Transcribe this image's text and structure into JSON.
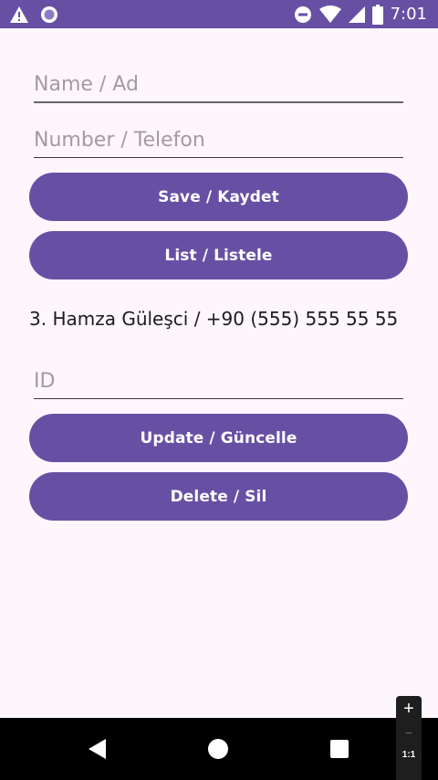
{
  "status_bar": {
    "time": "7:01",
    "icons": [
      "warning-icon",
      "circle-app-icon",
      "do-not-disturb-icon",
      "wifi-icon",
      "signal-icon",
      "battery-icon"
    ]
  },
  "form": {
    "name_placeholder": "Name / Ad",
    "number_placeholder": "Number / Telefon",
    "id_placeholder": "ID"
  },
  "buttons": {
    "save": "Save / Kaydet",
    "list": "List / Listele",
    "update": "Update / Güncelle",
    "delete": "Delete / Sil"
  },
  "result": "3. Hamza Güleşci / +90 (555) 555 55 55",
  "zoom": {
    "plus": "+",
    "minus": "−",
    "reset": "1:1"
  },
  "colors": {
    "primary": "#6750a4",
    "background": "#fdf7fd",
    "text": "#1d1b20",
    "hint": "#a39aa3"
  }
}
